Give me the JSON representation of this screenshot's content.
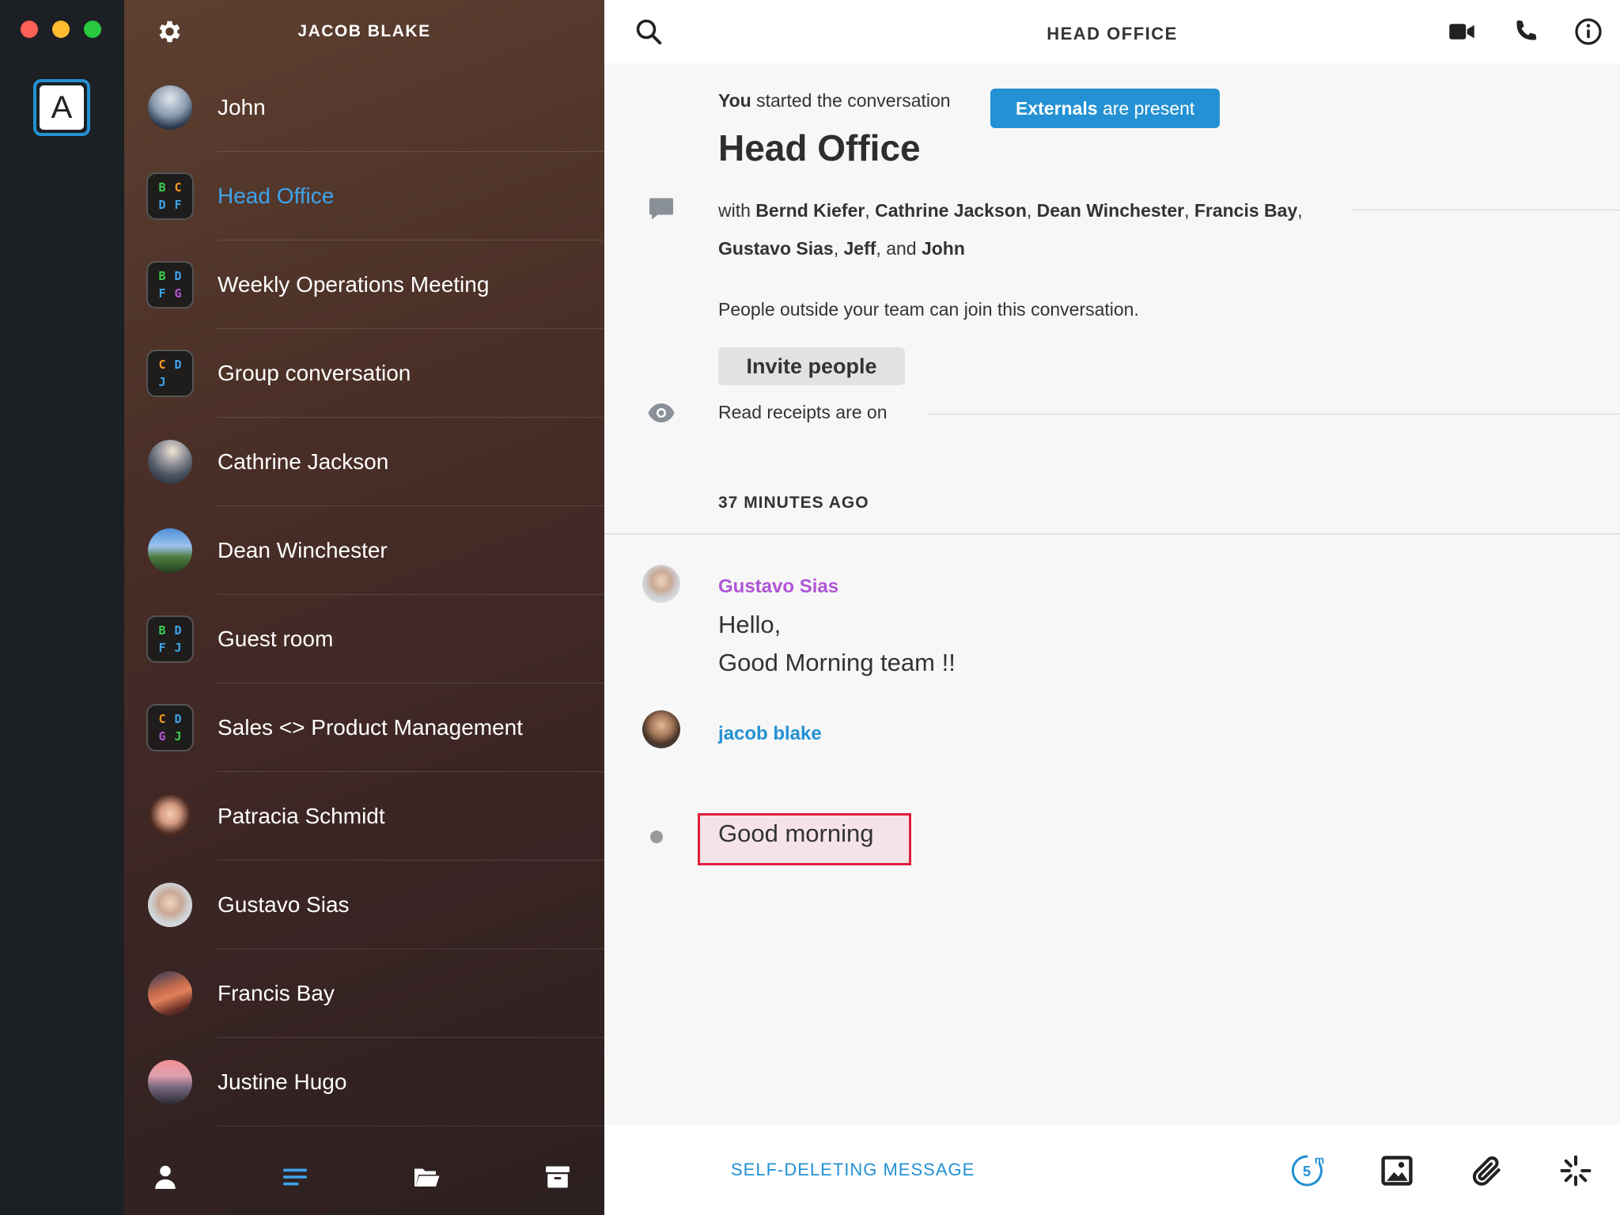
{
  "app": {
    "account_initial": "A",
    "accent": "#2391d3",
    "active_color": "#3da3ea",
    "highlight_color": "#e01e3c"
  },
  "sidebar": {
    "title": "JACOB BLAKE",
    "conversations": [
      {
        "name": "John",
        "type": "person"
      },
      {
        "name": "Head Office",
        "type": "group",
        "active": true,
        "letters": [
          "B",
          "C",
          "D",
          "F"
        ]
      },
      {
        "name": "Weekly Operations Meeting",
        "type": "group",
        "letters": [
          "B",
          "D",
          "F",
          "G"
        ]
      },
      {
        "name": "Group conversation",
        "type": "group",
        "letters": [
          "C",
          "D",
          "J",
          ""
        ]
      },
      {
        "name": "Cathrine Jackson",
        "type": "person"
      },
      {
        "name": "Dean Winchester",
        "type": "person"
      },
      {
        "name": "Guest room",
        "type": "group",
        "letters": [
          "B",
          "D",
          "F",
          "J"
        ]
      },
      {
        "name": "Sales <> Product Management",
        "type": "group",
        "letters": [
          "C",
          "D",
          "G",
          "J"
        ]
      },
      {
        "name": "Patracia Schmidt",
        "type": "person"
      },
      {
        "name": "Gustavo Sias",
        "type": "person"
      },
      {
        "name": "Francis Bay",
        "type": "person"
      },
      {
        "name": "Justine Hugo",
        "type": "person"
      }
    ],
    "footer_icons": [
      "person-icon",
      "conversations-icon",
      "folder-icon",
      "archive-icon"
    ]
  },
  "header": {
    "title": "HEAD OFFICE",
    "icons": [
      "search-icon",
      "video-call-icon",
      "phone-icon",
      "info-icon"
    ]
  },
  "intro": {
    "started_you": "You",
    "started_rest": " started the conversation",
    "externals_bold": "Externals",
    "externals_rest": " are present",
    "title": "Head Office",
    "with_prefix": "with ",
    "members": [
      "Bernd Kiefer",
      "Cathrine Jackson",
      "Dean Winchester",
      "Francis Bay",
      "Gustavo Sias",
      "Jeff",
      "John"
    ],
    "outside_notice": "People outside your team can join this conversation.",
    "invite_label": "Invite people",
    "receipts_text": "Read receipts are on"
  },
  "timeline": {
    "divider": "37 MINUTES AGO",
    "messages": [
      {
        "author": "Gustavo Sias",
        "color": "#b055d6",
        "lines": [
          "Hello,",
          "Good Morning team !!"
        ]
      },
      {
        "author": "jacob blake",
        "color": "#2391d3",
        "lines": [
          "Good morning"
        ]
      }
    ]
  },
  "composer": {
    "placeholder": "SELF-DELETING MESSAGE",
    "timer_label": "5",
    "timer_unit": "m",
    "icons": [
      "timer-icon",
      "image-icon",
      "attachment-icon",
      "ping-icon"
    ]
  }
}
